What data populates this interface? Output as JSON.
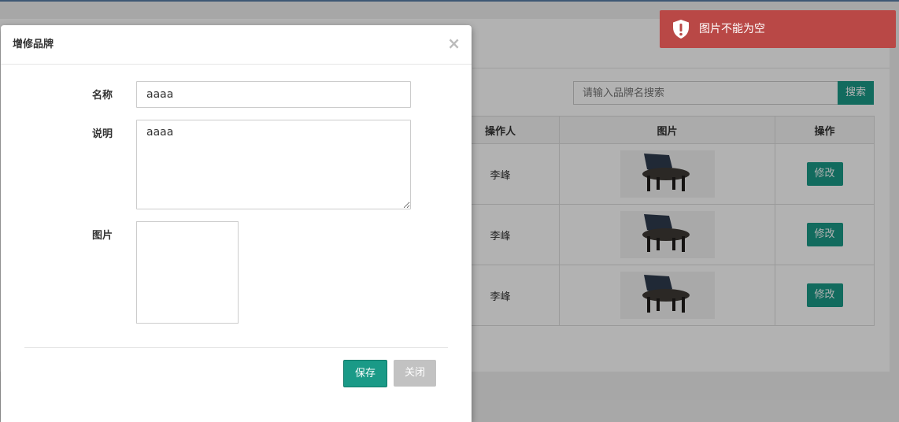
{
  "background": {
    "search": {
      "placeholder": "请输入品牌名搜索",
      "button_label": "搜索"
    },
    "table": {
      "headers": [
        "操作人",
        "图片",
        "操作"
      ],
      "rows": [
        {
          "operator": "李峰",
          "image": "chair-icon",
          "action_label": "修改"
        },
        {
          "operator": "李峰",
          "image": "chair-icon",
          "action_label": "修改"
        },
        {
          "operator": "李峰",
          "image": "chair-icon",
          "action_label": "修改"
        }
      ]
    }
  },
  "toast": {
    "icon": "shield-alert-icon",
    "message": "图片不能为空"
  },
  "modal": {
    "title": "增修品牌",
    "close_icon": "×",
    "fields": {
      "name_label": "名称",
      "name_value": "aaaa",
      "desc_label": "说明",
      "desc_value": "aaaa",
      "image_label": "图片"
    },
    "buttons": {
      "save_label": "保存",
      "close_label": "关闭"
    }
  },
  "colors": {
    "accent": "#1a9a87",
    "toast_bg": "#b94846",
    "disabled_btn": "#c2c2c2"
  }
}
